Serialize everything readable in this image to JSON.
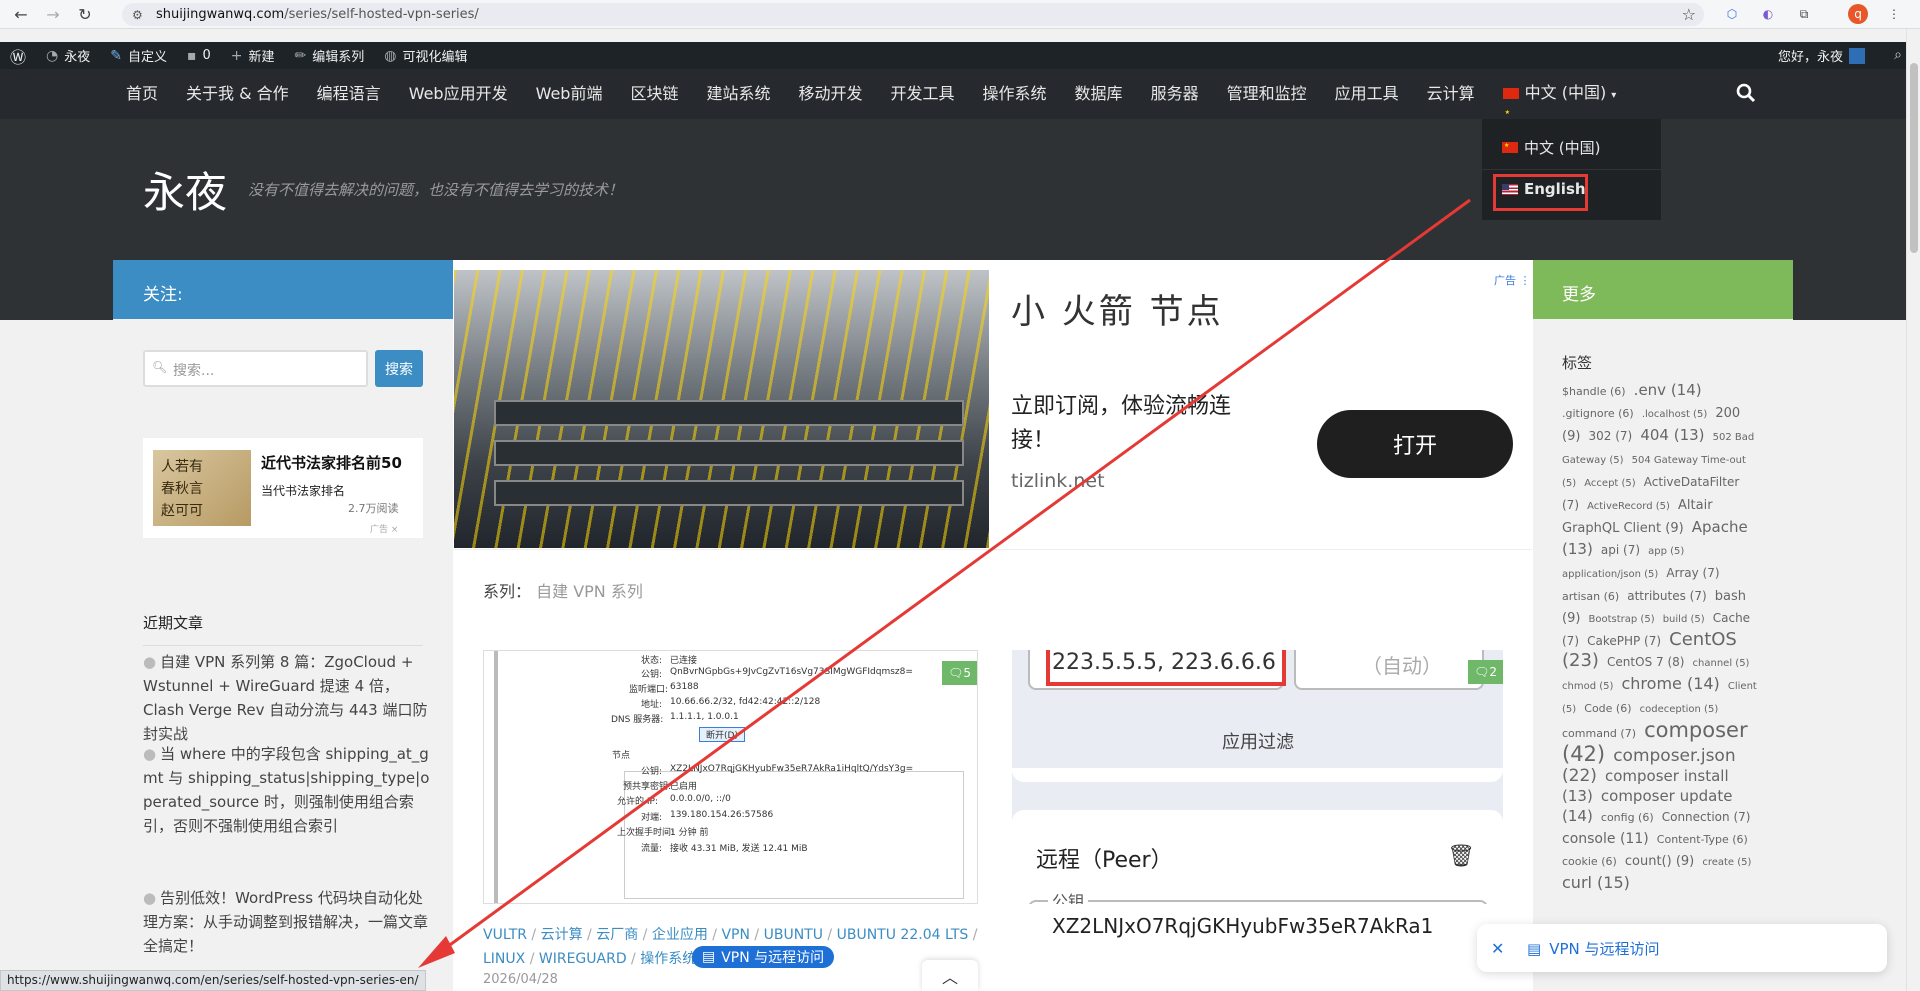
{
  "browser": {
    "url_domain": "shuijingwanwq.com",
    "url_path": "/series/self-hosted-vpn-series/",
    "profile_initial": "q"
  },
  "adminbar": {
    "site": "永夜",
    "customize": "自定义",
    "comments": "0",
    "new": "新建",
    "edit_series": "编辑系列",
    "visual_edit": "可视化编辑",
    "greeting": "您好，永夜"
  },
  "nav": {
    "items": [
      "首页",
      "关于我 & 合作",
      "编程语言",
      "Web应用开发",
      "Web前端",
      "区块链",
      "建站系统",
      "移动开发",
      "开发工具",
      "操作系统",
      "数据库",
      "服务器",
      "管理和监控",
      "应用工具",
      "云计算"
    ],
    "lang_current": "中文 (中国)"
  },
  "lang_dropdown": {
    "option_zh": "中文 (中国)",
    "option_en": "English"
  },
  "header": {
    "title": "永夜",
    "description": "没有不值得去解决的问题，也没有不值得去学习的技术！"
  },
  "sidebar_left": {
    "follow_title": "关注:",
    "search_placeholder": "搜索...",
    "search_button": "搜索",
    "ad": {
      "title": "近代书法家排名前50",
      "subtitle": "当代书法家排名",
      "reads": "2.7万阅读",
      "badge": "广告"
    },
    "recent_title": "近期文章",
    "recent_posts": [
      "自建 VPN 系列第 8 篇：ZgoCloud + Wstunnel + WireGuard 提速 4 倍，Clash Verge Rev 自动分流与 443 端口防封实战",
      "当 where 中的字段包含 shipping_at_gmt 与 shipping_status|shipping_type|operated_source 时，则强制使用组合索引，否则不强制使用组合索引",
      "告别低效！WordPress 代码块自动化处理方案：从手动调整到报错解决，一篇文章全搞定！"
    ]
  },
  "big_ad": {
    "heading": "小 火箭 节点",
    "text": "立即订阅，体验流畅连接！",
    "domain": "tizlink.net",
    "button": "打开",
    "label": "广告"
  },
  "series": {
    "label": "系列：",
    "name": "自建 VPN 系列"
  },
  "thumb1": {
    "comments": "5",
    "rows": [
      [
        "状态:",
        "已连接"
      ],
      [
        "公钥:",
        "QnBvrNGpbGs+9JvCgZvT16sVg73SIMgWGFIdqmsz8="
      ],
      [
        "监听端口:",
        "63188"
      ],
      [
        "地址:",
        "10.66.66.2/32, fd42:42:42::2/128"
      ],
      [
        "DNS 服务器:",
        "1.1.1.1, 1.0.0.1"
      ],
      [
        "",
        "断开(D)"
      ],
      [
        "节点",
        ""
      ],
      [
        "公钥:",
        "XZ2LNJxO7RqjGKHyubFw35eR7AkRa1iHqltQ/YdsY3g="
      ],
      [
        "预共享密钥:",
        "已启用"
      ],
      [
        "允许的 IP:",
        "0.0.0.0/0, ::/0"
      ],
      [
        "对端:",
        "139.180.154.26:57586"
      ],
      [
        "上次握手时间:",
        "1 分钟 前"
      ],
      [
        "流量:",
        "接收 43.31 MiB, 发送 12.41 MiB"
      ]
    ]
  },
  "thumb2": {
    "comments": "2",
    "dns": "223.5.5.5, 223.6.6.6",
    "auto": "（自动）",
    "filter": "应用过滤",
    "peer_title": "远程（Peer）",
    "key_label": "公钥",
    "key_value": "XZ2LNJxO7RqjGKHyubFw35eR7AkRa1"
  },
  "post": {
    "tags": [
      "VULTR",
      "云计算",
      "云厂商",
      "企业应用",
      "VPN",
      "UBUNTU",
      "UBUNTU 22.04 LTS",
      "LINUX",
      "WIREGUARD",
      "操作系统"
    ],
    "date": "2026/04/28",
    "vpn_pill": "VPN 与远程访问"
  },
  "sidebar_right": {
    "more_title": "更多",
    "tag_title": "标签",
    "tags": [
      {
        "t": "$handle (6)",
        "s": 11
      },
      {
        "t": ".env (14)",
        "s": 15
      },
      {
        "t": ".gitignore (6)",
        "s": 11
      },
      {
        "t": ".localhost (5)",
        "s": 10
      },
      {
        "t": "200 (9)",
        "s": 13
      },
      {
        "t": "302 (7)",
        "s": 12
      },
      {
        "t": "404 (13)",
        "s": 15
      },
      {
        "t": "502 Bad Gateway (5)",
        "s": 10
      },
      {
        "t": "504 Gateway Time-out (5)",
        "s": 10
      },
      {
        "t": "Accept (5)",
        "s": 10
      },
      {
        "t": "ActiveDataFilter (7)",
        "s": 12
      },
      {
        "t": "ActiveRecord (5)",
        "s": 10
      },
      {
        "t": "Altair GraphQL Client (9)",
        "s": 13
      },
      {
        "t": "Apache (13)",
        "s": 15
      },
      {
        "t": "api (7)",
        "s": 12
      },
      {
        "t": "app (5)",
        "s": 10
      },
      {
        "t": "application/json (5)",
        "s": 10
      },
      {
        "t": "Array (7)",
        "s": 12
      },
      {
        "t": "artisan (6)",
        "s": 11
      },
      {
        "t": "attributes (7)",
        "s": 12
      },
      {
        "t": "bash (9)",
        "s": 13
      },
      {
        "t": "Bootstrap (5)",
        "s": 10
      },
      {
        "t": "build (5)",
        "s": 10
      },
      {
        "t": "Cache (7)",
        "s": 12
      },
      {
        "t": "CakePHP (7)",
        "s": 12
      },
      {
        "t": "CentOS (23)",
        "s": 18
      },
      {
        "t": "CentOS 7 (8)",
        "s": 12
      },
      {
        "t": "channel (5)",
        "s": 10
      },
      {
        "t": "chmod (5)",
        "s": 10
      },
      {
        "t": "chrome (14)",
        "s": 16
      },
      {
        "t": "Client (5)",
        "s": 10
      },
      {
        "t": "Code (6)",
        "s": 11
      },
      {
        "t": "codeception (5)",
        "s": 10
      },
      {
        "t": "command (7)",
        "s": 11
      },
      {
        "t": "composer (42)",
        "s": 21
      },
      {
        "t": "composer.json (22)",
        "s": 17
      },
      {
        "t": "composer install (13)",
        "s": 15
      },
      {
        "t": "composer update (14)",
        "s": 15
      },
      {
        "t": "config (6)",
        "s": 11
      },
      {
        "t": "Connection (7)",
        "s": 12
      },
      {
        "t": "console (11)",
        "s": 14
      },
      {
        "t": "Content-Type (6)",
        "s": 11
      },
      {
        "t": "cookie (6)",
        "s": 11
      },
      {
        "t": "count() (9)",
        "s": 13
      },
      {
        "t": "create (5)",
        "s": 10
      },
      {
        "t": "curl (15)",
        "s": 16
      }
    ]
  },
  "bottom": {
    "status_url": "https://www.shuijingwanwq.com/en/series/self-hosted-vpn-series-en/",
    "toc_label": "VPN 与远程访问"
  }
}
